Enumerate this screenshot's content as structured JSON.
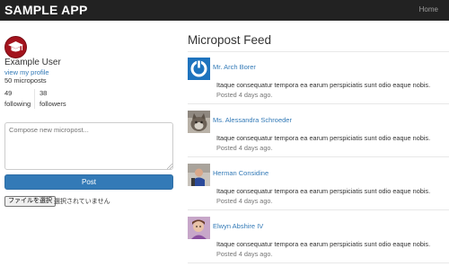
{
  "navbar": {
    "brand": "SAMPLE APP",
    "links": [
      {
        "label": "Home"
      }
    ]
  },
  "user": {
    "name": "Example User",
    "profile_link": "view my profile",
    "micropost_count": "50 microposts",
    "following_count": "49",
    "following_label": "following",
    "followers_count": "38",
    "followers_label": "followers",
    "avatar_icon": "gravatar-icon"
  },
  "compose": {
    "placeholder": "Compose new micropost...",
    "value": "",
    "submit_label": "Post",
    "file_button_label": "ファイルを選択",
    "file_status": "選択されていません"
  },
  "feed": {
    "title": "Micropost Feed",
    "items": [
      {
        "author": "Mr. Arch Borer",
        "content": "Itaque consequatur tempora ea earum perspiciatis sunt odio eaque nobis.",
        "timestamp": "Posted 4 days ago.",
        "avatar_icon": "gravatar-icon"
      },
      {
        "author": "Ms. Alessandra Schroeder",
        "content": "Itaque consequatur tempora ea earum perspiciatis sunt odio eaque nobis.",
        "timestamp": "Posted 4 days ago.",
        "avatar_icon": "cat-avatar-icon"
      },
      {
        "author": "Herman Considine",
        "content": "Itaque consequatur tempora ea earum perspiciatis sunt odio eaque nobis.",
        "timestamp": "Posted 4 days ago.",
        "avatar_icon": "person-avatar-icon"
      },
      {
        "author": "Elwyn Abshire IV",
        "content": "Itaque consequatur tempora ea earum perspiciatis sunt odio eaque nobis.",
        "timestamp": "Posted 4 days ago.",
        "avatar_icon": "child-avatar-icon"
      }
    ]
  },
  "colors": {
    "navbar_bg": "#222222",
    "link": "#337ab7",
    "primary_button": "#337ab7",
    "avatar_red": "#a3131d",
    "gravatar_blue": "#1e73be"
  }
}
